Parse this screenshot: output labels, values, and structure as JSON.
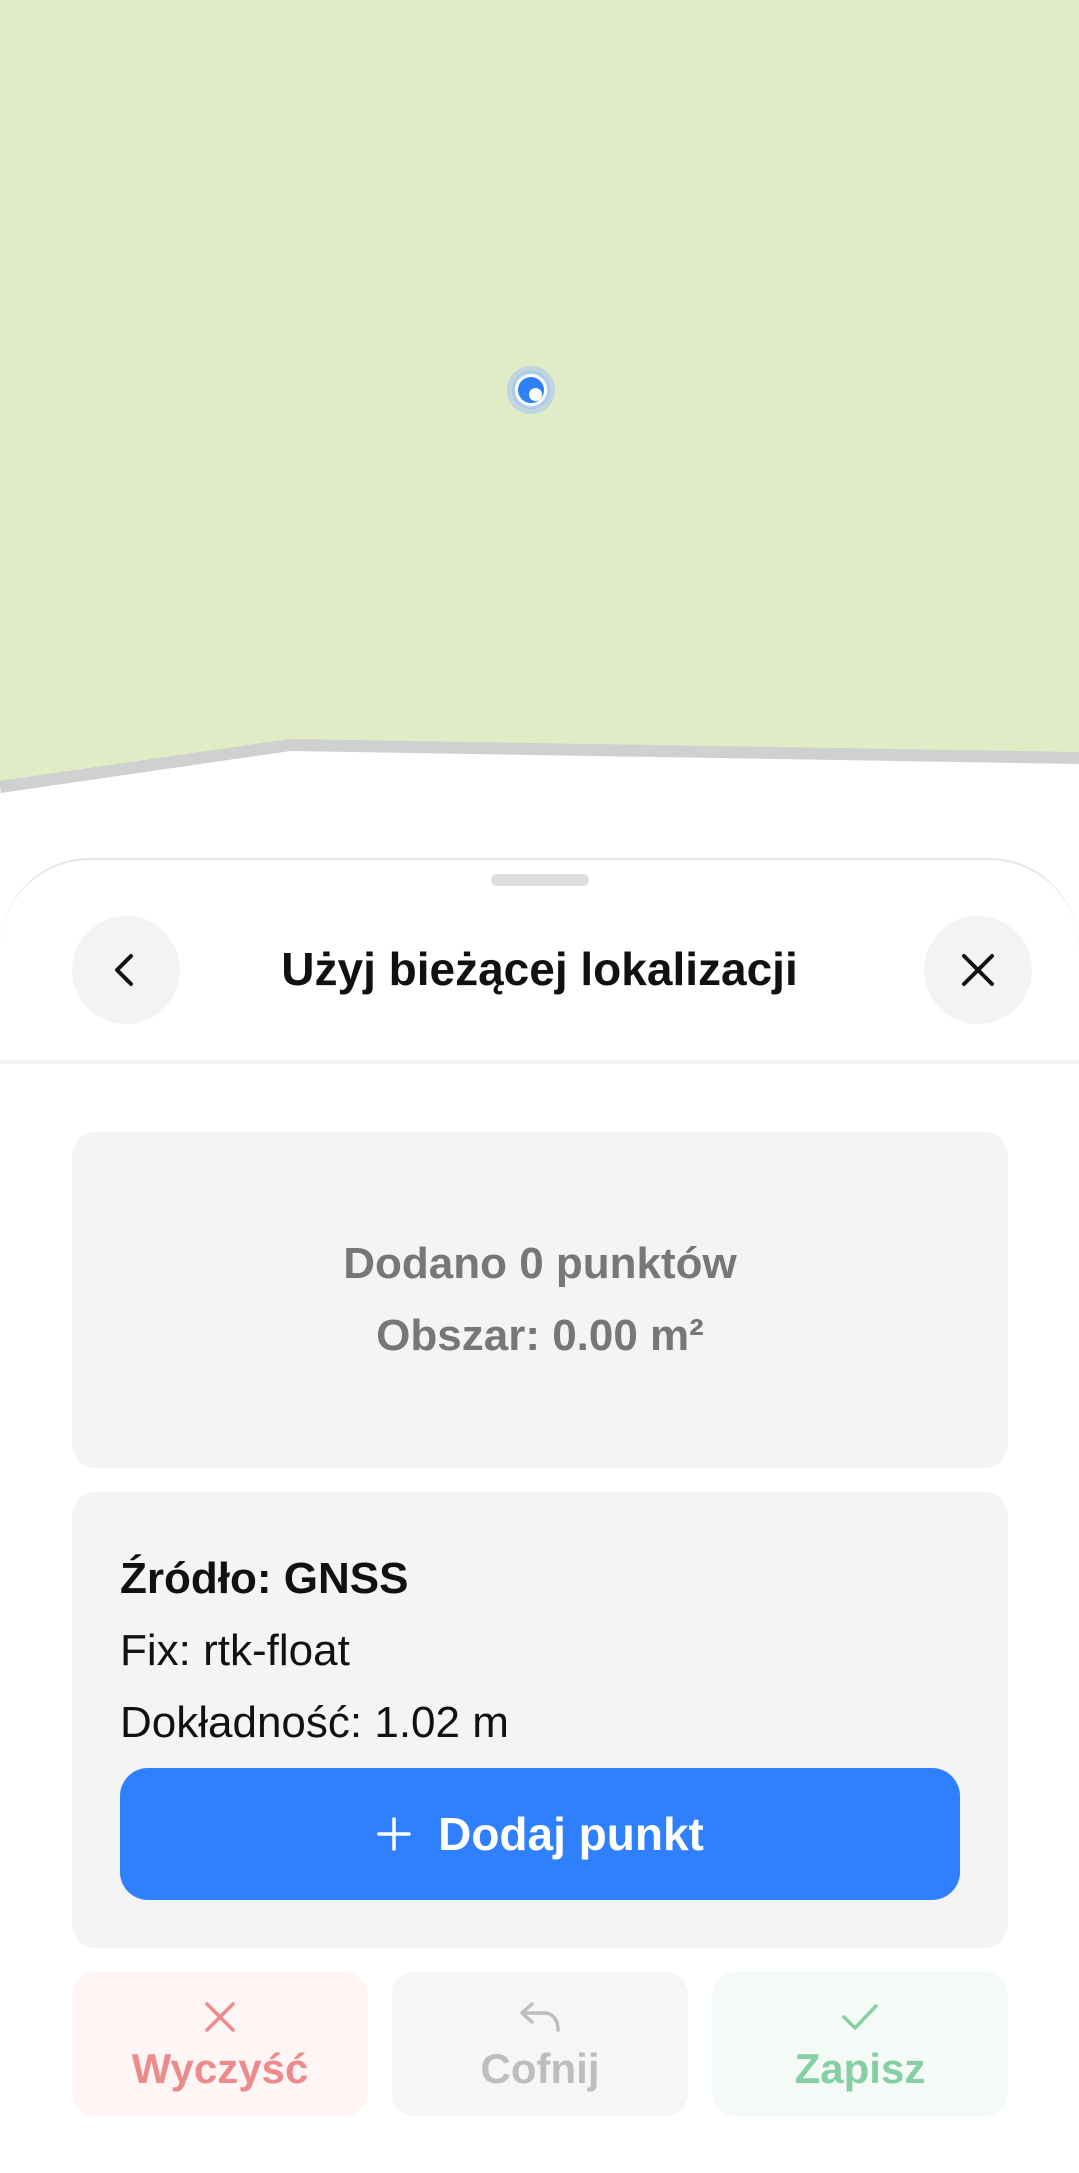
{
  "map": {
    "land_color": "#e0ecc6",
    "road_color": "#d0d0d0",
    "location_marker_color": "#2f7ff5"
  },
  "sheet": {
    "title": "Użyj bieżącej lokalizacji",
    "back_icon": "chevron-left-icon",
    "close_icon": "close-icon"
  },
  "stats": {
    "points_text": "Dodano 0 punktów",
    "area_text": "Obszar: 0.00 m²"
  },
  "gnss": {
    "source_text": "Źródło: GNSS",
    "fix_text": "Fix: rtk-float",
    "accuracy_text": "Dokładność: 1.02 m",
    "add_button_label": "Dodaj punkt",
    "add_button_color": "#2f80ff"
  },
  "actions": {
    "clear_label": "Wyczyść",
    "undo_label": "Cofnij",
    "save_label": "Zapisz"
  }
}
